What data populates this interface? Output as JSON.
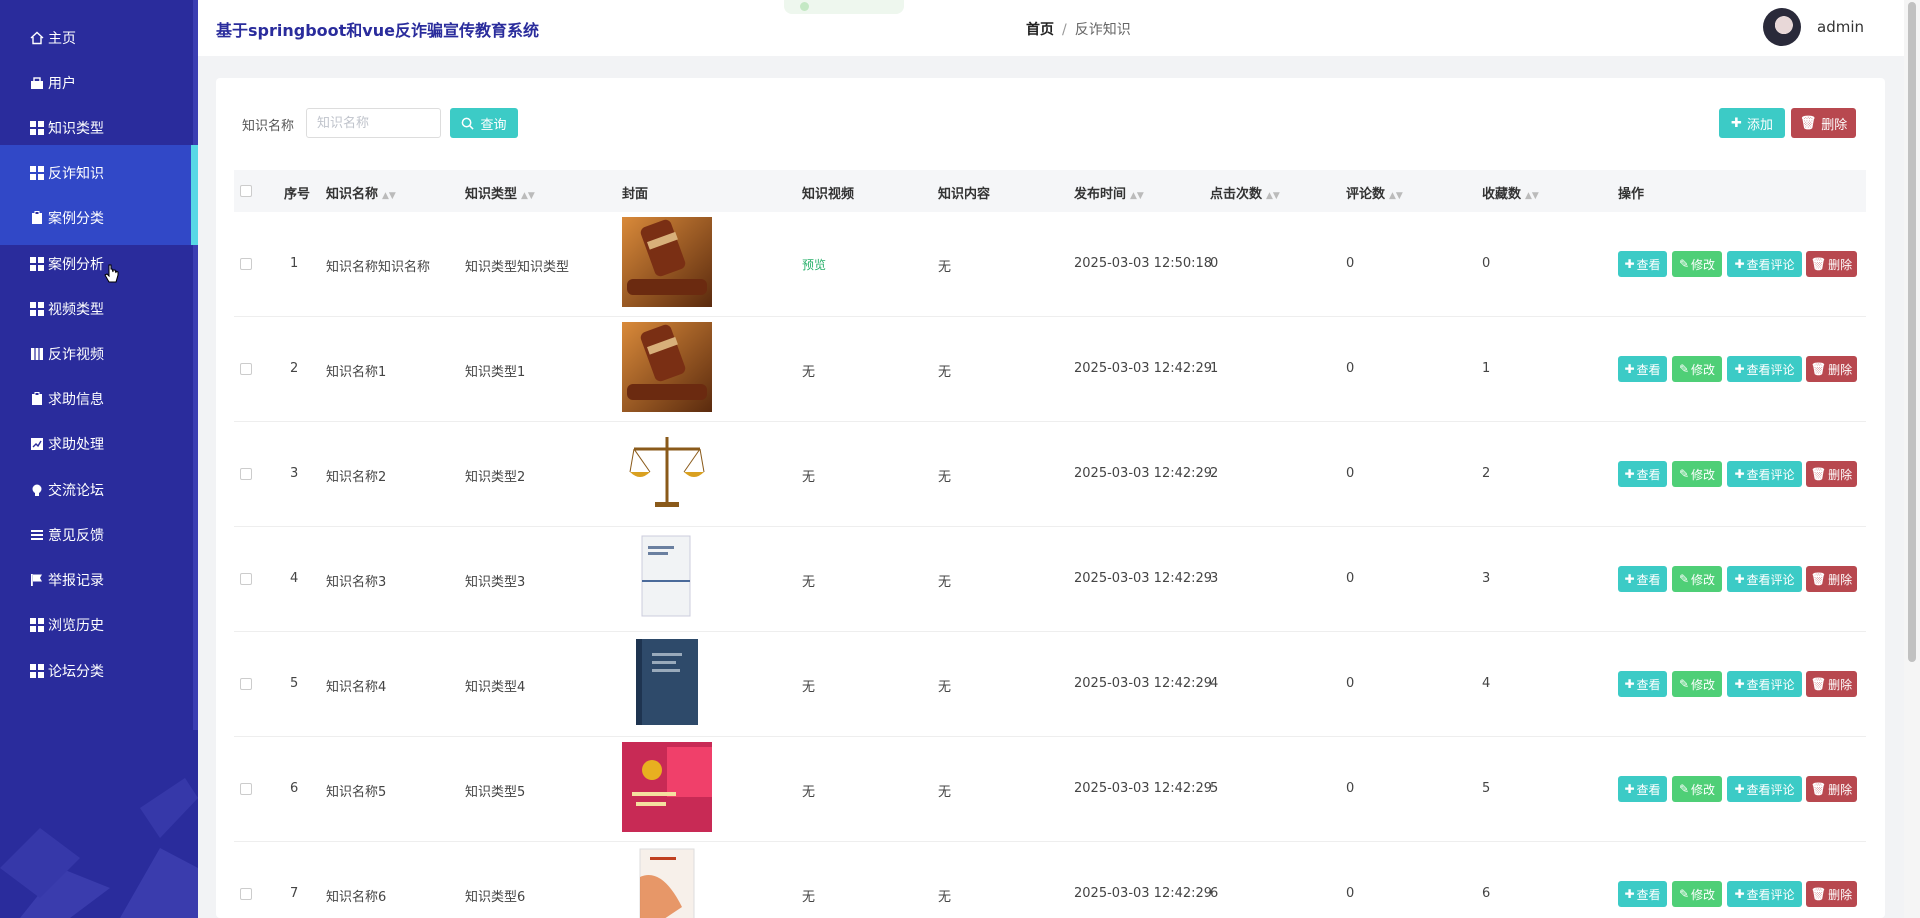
{
  "app": {
    "title": "基于springboot和vue反诈骗宣传教育系统",
    "user": "admin"
  },
  "breadcrumb": {
    "home": "首页",
    "separator": "/",
    "current": "反诈知识"
  },
  "sidebar": {
    "items": [
      {
        "label": "主页",
        "icon": "home-icon"
      },
      {
        "label": "用户",
        "icon": "user-icon"
      },
      {
        "label": "知识类型",
        "icon": "grid-icon"
      },
      {
        "label": "反诈知识",
        "icon": "grid-icon"
      },
      {
        "label": "案例分类",
        "icon": "clipboard-icon"
      },
      {
        "label": "案例分析",
        "icon": "grid-icon"
      },
      {
        "label": "视频类型",
        "icon": "grid-icon"
      },
      {
        "label": "反诈视频",
        "icon": "book-icon"
      },
      {
        "label": "求助信息",
        "icon": "clipboard-icon"
      },
      {
        "label": "求助处理",
        "icon": "chart-icon"
      },
      {
        "label": "交流论坛",
        "icon": "bulb-icon"
      },
      {
        "label": "意见反馈",
        "icon": "list-icon"
      },
      {
        "label": "举报记录",
        "icon": "flag-icon"
      },
      {
        "label": "浏览历史",
        "icon": "grid-icon"
      },
      {
        "label": "论坛分类",
        "icon": "grid-icon"
      }
    ]
  },
  "search": {
    "label": "知识名称",
    "placeholder": "知识名称",
    "query_button": "查询"
  },
  "toolbar": {
    "add_button": "添加",
    "delete_button": "删除"
  },
  "table": {
    "headers": {
      "index": "序号",
      "name": "知识名称",
      "type": "知识类型",
      "cover": "封面",
      "video": "知识视频",
      "content": "知识内容",
      "time": "发布时间",
      "clicks": "点击次数",
      "comments": "评论数",
      "favorites": "收藏数",
      "actions": "操作"
    },
    "action_labels": {
      "view": "查看",
      "edit": "修改",
      "view_comments": "查看评论",
      "delete": "删除"
    },
    "rows": [
      {
        "index": "1",
        "name": "知识名称知识名称",
        "type": "知识类型知识类型",
        "cover": "gavel",
        "video": "预览",
        "content": "无",
        "time": "2025-03-03 12:50:18",
        "clicks": "0",
        "comments": "0",
        "favorites": "0"
      },
      {
        "index": "2",
        "name": "知识名称1",
        "type": "知识类型1",
        "cover": "gavel",
        "video": "无",
        "content": "无",
        "time": "2025-03-03 12:42:29",
        "clicks": "1",
        "comments": "0",
        "favorites": "1"
      },
      {
        "index": "3",
        "name": "知识名称2",
        "type": "知识类型2",
        "cover": "scales",
        "video": "无",
        "content": "无",
        "time": "2025-03-03 12:42:29",
        "clicks": "2",
        "comments": "0",
        "favorites": "2"
      },
      {
        "index": "4",
        "name": "知识名称3",
        "type": "知识类型3",
        "cover": "white-book",
        "video": "无",
        "content": "无",
        "time": "2025-03-03 12:42:29",
        "clicks": "3",
        "comments": "0",
        "favorites": "3"
      },
      {
        "index": "5",
        "name": "知识名称4",
        "type": "知识类型4",
        "cover": "blue-book",
        "video": "无",
        "content": "无",
        "time": "2025-03-03 12:42:29",
        "clicks": "4",
        "comments": "0",
        "favorites": "4"
      },
      {
        "index": "6",
        "name": "知识名称5",
        "type": "知识类型5",
        "cover": "red-book",
        "video": "无",
        "content": "无",
        "time": "2025-03-03 12:42:29",
        "clicks": "5",
        "comments": "0",
        "favorites": "5"
      },
      {
        "index": "7",
        "name": "知识名称6",
        "type": "知识类型6",
        "cover": "orange-book",
        "video": "无",
        "content": "无",
        "time": "2025-03-03 12:42:29",
        "clicks": "6",
        "comments": "0",
        "favorites": "6"
      }
    ]
  },
  "colors": {
    "sidebar_bg": "#2a2c9c",
    "sidebar_active": "#3148c7",
    "accent_teal": "#3ccbc6",
    "accent_green": "#4fcf77",
    "danger": "#b8484f"
  }
}
